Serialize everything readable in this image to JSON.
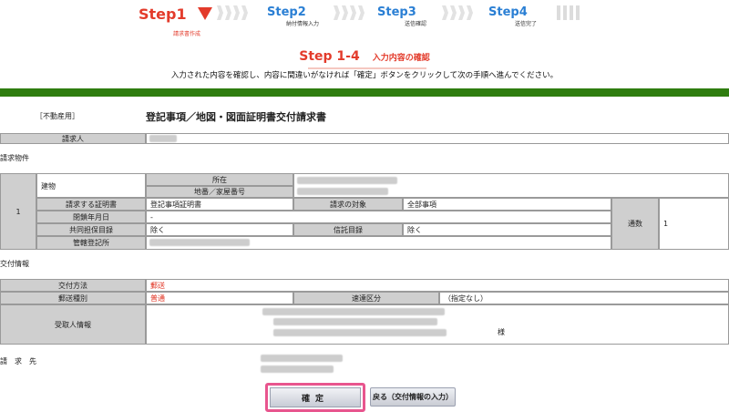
{
  "steps": [
    {
      "label": "Step1",
      "sub": "請求書作成"
    },
    {
      "label": "Step2",
      "sub": "納付情報入力"
    },
    {
      "label": "Step3",
      "sub": "送信確認"
    },
    {
      "label": "Step4",
      "sub": "送信完了"
    }
  ],
  "section": {
    "step": "Step 1-4",
    "title": "入力内容の確認"
  },
  "intro": "入力された内容を確認し、内容に間違いがなければ「確定」ボタンをクリックして次の手順へ進んでください。",
  "form": {
    "category": "［不動産用］",
    "title": "登記事項／地図・図面証明書交付請求書",
    "requester_label": "請求人",
    "property_section": "請求物件",
    "row_number": "1",
    "building_label": "建物",
    "location_label": "所在",
    "lot_label": "地番／家屋番号",
    "cert_label": "請求する証明書",
    "cert_value": "登記事項証明書",
    "target_label": "請求の対象",
    "target_value": "全部事項",
    "closed_date_label": "閉鎖年月日",
    "closed_date_value": "-",
    "joint_label": "共同担保目録",
    "joint_value": "除く",
    "trust_label": "信託目録",
    "trust_value": "除く",
    "copies_label": "通数",
    "copies_value": "1",
    "office_label": "管轄登記所"
  },
  "delivery": {
    "section": "交付情報",
    "method_label": "交付方法",
    "method_value": "郵送",
    "mail_label": "郵送種別",
    "mail_value": "普通",
    "express_label": "速達区分",
    "express_value": "（指定なし）",
    "recipient_label": "受取人情報",
    "honorific": "様"
  },
  "billing_label": "請　求　先",
  "buttons": {
    "confirm": "確定",
    "back": "戻る（交付情報の入力）"
  },
  "colors": {
    "accent_red": "#e33b2b",
    "step_blue": "#2a7fd4",
    "green_bar": "#2f7d0f",
    "highlight_pink": "#e8558e"
  }
}
